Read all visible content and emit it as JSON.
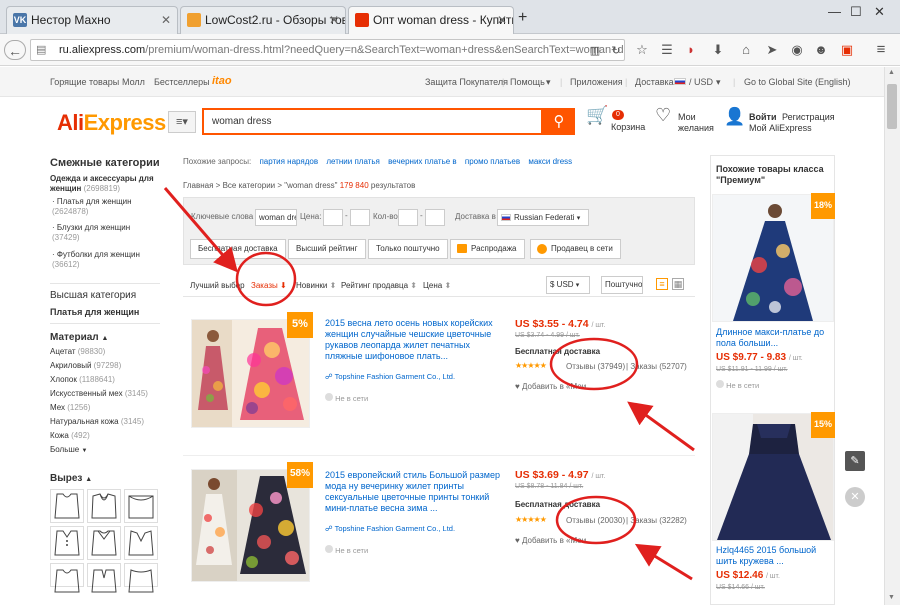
{
  "tabs": [
    {
      "label": "Нестор Махно",
      "favicon": "VK"
    },
    {
      "label": "LowCost2.ru - Обзоры тов...",
      "favicon": "LC"
    },
    {
      "label": "Опт woman dress - Купить...",
      "favicon": "AE"
    }
  ],
  "url": {
    "host": "ru.aliexpress.com",
    "path": "/premium/woman-dress.html?needQuery=n&SearchText=woman+dress&enSearchText=woman+dres"
  },
  "topstrip": {
    "left": [
      "Горящие товары",
      "Молл",
      "Бестселлеры",
      "itao"
    ],
    "right": [
      "Защита Покупателя",
      "Помощь",
      "Приложения",
      "Доставка в",
      "/ USD",
      "Go to Global Site (English)"
    ]
  },
  "header": {
    "logo_ali": "Ali",
    "logo_express": "Express",
    "menu_label": "≡▾",
    "search_value": "woman dress",
    "cart_count": "0",
    "cart_label": "Корзина",
    "wish_line1": "Мои",
    "wish_line2": "желания",
    "login": "Войти",
    "register": "Регистрация",
    "myali": "Мой AliExpress"
  },
  "sidebar": {
    "related_title": "Смежные категории",
    "main_cat": "Одежда и аксессуары для женщин",
    "main_cnt": "(2698819)",
    "subcats": [
      {
        "label": "Платья для женщин",
        "cnt": "(2624878)"
      },
      {
        "label": "Блузки для женщин",
        "cnt": "(37429)"
      },
      {
        "label": "Футболки для женщин",
        "cnt": "(36612)"
      }
    ],
    "top_cat_title": "Высшая категория",
    "top_cat_value": "Платья для женщин",
    "material_title": "Материал",
    "materials": [
      {
        "label": "Ацетат",
        "cnt": "(98830)"
      },
      {
        "label": "Акриловый",
        "cnt": "(97298)"
      },
      {
        "label": "Хлопок",
        "cnt": "(1188641)"
      },
      {
        "label": "Искусственный мех",
        "cnt": "(3145)"
      },
      {
        "label": "Мех",
        "cnt": "(1256)"
      },
      {
        "label": "Натуральная кожа",
        "cnt": "(3145)"
      },
      {
        "label": "Кожа",
        "cnt": "(492)"
      }
    ],
    "more": "Больше",
    "neck_title": "Вырез"
  },
  "related": {
    "label": "Похожие запросы:",
    "items": [
      "партия нарядов",
      "летнии платья",
      "вечерних платье в",
      "промо платьев",
      "макси dress"
    ]
  },
  "breadcrumb": {
    "path": "Главная > Все категории > \"woman dress\"",
    "count": "179 840",
    "suffix": "результатов"
  },
  "filters": {
    "keywords_label": "Ключевые слова :",
    "keywords_value": "woman dre",
    "price_label": "Цена:",
    "qty_label": "Кол-во:",
    "ship_label": "Доставка в",
    "ship_value": "Russian Federati",
    "buttons": [
      "Бесплатная доставка",
      "Высший рейтинг",
      "Только поштучно",
      "Распродажа",
      "Продавец в сети"
    ]
  },
  "sort": {
    "items": [
      "Лучший выбор",
      "Заказы",
      "Новинки",
      "Рейтинг продавца",
      "Цена"
    ],
    "currency": "$ USD",
    "piece": "Поштучно"
  },
  "products": [
    {
      "discount": "5%",
      "title": "2015 весна лето осень новых корейских женщин случайные чешские цветочные рукавов леопарда жилет печатных пляжные шифоновое плать...",
      "seller": "Topshine Fashion Garment Co., Ltd.",
      "offline": "Не в сети",
      "price": "US $3.55 - 4.74",
      "per": "/ шт.",
      "old": "US $3.74 - 4.99 / шт.",
      "shipping": "Бесплатная доставка",
      "reviews": "Отзывы (37949)",
      "orders": "Заказы (52707)",
      "wish": "Добавить в «Мои"
    },
    {
      "discount": "58%",
      "title": "2015 европейский стиль Большой размер мода ну вечеринку жилет принты сексуальные цветочные принты тонкий мини-платье весна зима ...",
      "seller": "Topshine Fashion Garment Co., Ltd.",
      "offline": "Не в сети",
      "price": "US $3.69 - 4.97",
      "per": "/ шт.",
      "old": "US $8.78 - 11.84 / шт.",
      "shipping": "Бесплатная доставка",
      "reviews": "Отзывы (20030)",
      "orders": "Заказы (32282)",
      "wish": "Добавить в «Мои"
    }
  ],
  "right": {
    "title": "Похожие товары класса \"Премиум\"",
    "items": [
      {
        "discount": "18%",
        "title": "Длинное макси-платье до пола больши...",
        "price": "US $9.77 - 9.83",
        "per": "/ шт.",
        "old": "US $11.91 - 11.99 / шт.",
        "offline": "Не в сети"
      },
      {
        "discount": "15%",
        "title": "Hzlq4465 2015 большой шить кружева ...",
        "price": "US $12.46",
        "per": "/ шт.",
        "old": "US $14.66 / шт."
      }
    ]
  },
  "colors": {
    "brand": "#e62e04",
    "accent": "#f90",
    "link": "#0066cc",
    "annotation": "#e0201e"
  }
}
